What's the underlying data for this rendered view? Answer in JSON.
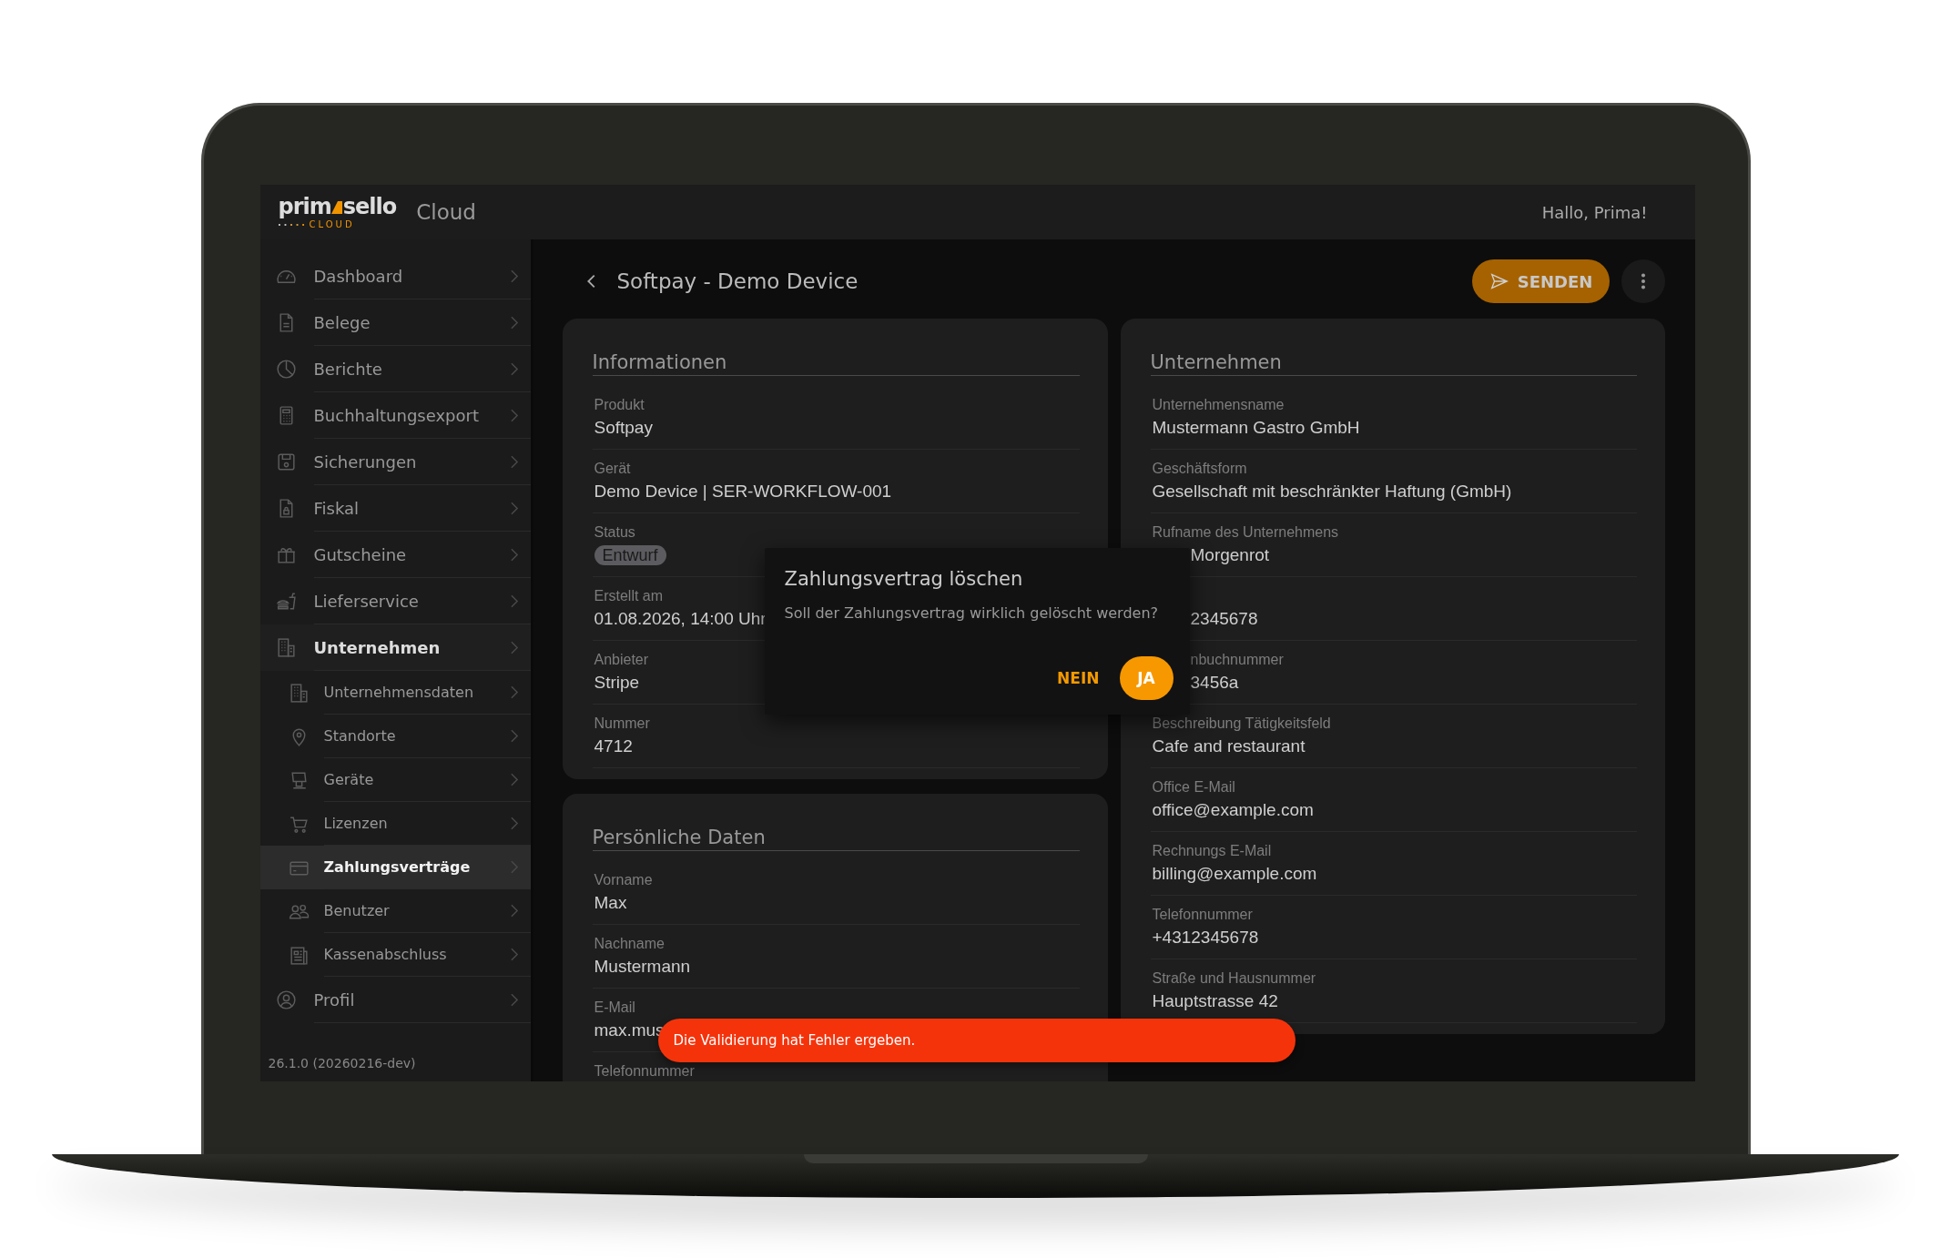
{
  "brand": {
    "name_start": "prim",
    "name_end": "sello",
    "tagline": "CLOUD"
  },
  "app_name": "Cloud",
  "greeting": "Hallo, Prima!",
  "sidebar": {
    "items": [
      {
        "label": "Dashboard",
        "selected": false,
        "expanded": false
      },
      {
        "label": "Belege",
        "selected": false,
        "expanded": false
      },
      {
        "label": "Berichte",
        "selected": false,
        "expanded": false
      },
      {
        "label": "Buchhaltungsexport",
        "selected": false,
        "expanded": false
      },
      {
        "label": "Sicherungen",
        "selected": false,
        "expanded": false
      },
      {
        "label": "Fiskal",
        "selected": false,
        "expanded": false
      },
      {
        "label": "Gutscheine",
        "selected": false,
        "expanded": false
      },
      {
        "label": "Lieferservice",
        "selected": false,
        "expanded": false
      },
      {
        "label": "Unternehmen",
        "selected": false,
        "expanded": true,
        "children": [
          {
            "label": "Unternehmensdaten",
            "selected": false
          },
          {
            "label": "Standorte",
            "selected": false
          },
          {
            "label": "Geräte",
            "selected": false
          },
          {
            "label": "Lizenzen",
            "selected": false
          },
          {
            "label": "Zahlungsverträge",
            "selected": true
          },
          {
            "label": "Benutzer",
            "selected": false
          },
          {
            "label": "Kassenabschluss",
            "selected": false
          }
        ]
      },
      {
        "label": "Profil",
        "selected": false,
        "expanded": false
      }
    ],
    "version": "26.1.0 (20260216-dev)"
  },
  "page": {
    "title": "Softpay - Demo Device",
    "actions": [
      {
        "kind": "primary",
        "label": "SENDEN"
      },
      {
        "kind": "more"
      }
    ]
  },
  "left_column": [
    {
      "title": "Informationen",
      "fields": [
        {
          "kind": "text",
          "label": "Produkt",
          "value": "Softpay"
        },
        {
          "kind": "text",
          "label": "Gerät",
          "value": "Demo Device | SER-WORKFLOW-001"
        },
        {
          "kind": "chip",
          "label": "Status",
          "value": "Entwurf"
        },
        {
          "kind": "text",
          "label": "Erstellt am",
          "value": "01.08.2026, 14:00 Uhr"
        },
        {
          "kind": "text",
          "label": "Anbieter",
          "value": "Stripe"
        },
        {
          "kind": "text",
          "label": "Nummer",
          "value": "4712"
        }
      ]
    },
    {
      "title": "Persönliche Daten",
      "fields": [
        {
          "kind": "text",
          "label": "Vorname",
          "value": "Max"
        },
        {
          "kind": "text",
          "label": "Nachname",
          "value": "Mustermann"
        },
        {
          "kind": "text",
          "label": "E-Mail",
          "value": "max.mus"
        },
        {
          "kind": "text",
          "label": "Telefonnummer"
        }
      ]
    }
  ],
  "right_column": [
    {
      "title": "Unternehmen",
      "fields": [
        {
          "kind": "text",
          "label": "Unternehmensname",
          "value": "Mustermann Gastro GmbH"
        },
        {
          "kind": "text",
          "label": "Geschäftsform",
          "value": "Gesellschaft mit beschränkter Haftung (GmbH)"
        },
        {
          "kind": "text",
          "label": "Rufname des Unternehmens",
          "value": "Morgenrot",
          "value_partly_hidden": true
        },
        {
          "kind": "text",
          "value": "2345678",
          "value_partly_hidden": true
        },
        {
          "kind": "text",
          "label": "nbuchnummer",
          "value": "3456a",
          "label_partly_hidden": true,
          "value_partly_hidden": true
        },
        {
          "kind": "text",
          "label": "Beschreibung Tätigkeitsfeld",
          "value": "Cafe and restaurant"
        },
        {
          "kind": "text",
          "label": "Office E-Mail",
          "value": "office@example.com"
        },
        {
          "kind": "text",
          "label": "Rechnungs E-Mail",
          "value": "billing@example.com"
        },
        {
          "kind": "text",
          "label": "Telefonnummer",
          "value": "+4312345678"
        },
        {
          "kind": "text",
          "label": "Straße und Hausnummer",
          "value": "Hauptstrasse 42"
        }
      ]
    }
  ],
  "dialog": {
    "title": "Zahlungsvertrag löschen",
    "message": "Soll der Zahlungsvertrag wirklich gelöscht werden?",
    "buttons": [
      {
        "kind": "text",
        "label": "NEIN"
      },
      {
        "kind": "filled",
        "label": "JA"
      }
    ]
  },
  "snackbar": {
    "message": "Die Validierung hat Fehler ergeben."
  }
}
